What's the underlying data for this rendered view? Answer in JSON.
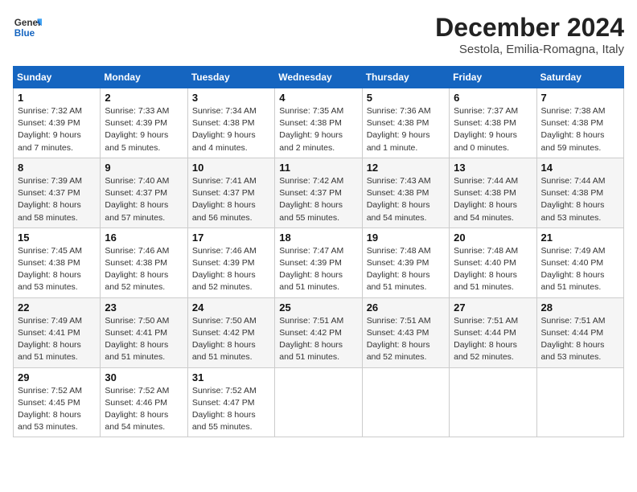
{
  "header": {
    "logo_general": "General",
    "logo_blue": "Blue",
    "month_title": "December 2024",
    "subtitle": "Sestola, Emilia-Romagna, Italy"
  },
  "days_of_week": [
    "Sunday",
    "Monday",
    "Tuesday",
    "Wednesday",
    "Thursday",
    "Friday",
    "Saturday"
  ],
  "weeks": [
    [
      {
        "day": 1,
        "info": "Sunrise: 7:32 AM\nSunset: 4:39 PM\nDaylight: 9 hours and 7 minutes."
      },
      {
        "day": 2,
        "info": "Sunrise: 7:33 AM\nSunset: 4:39 PM\nDaylight: 9 hours and 5 minutes."
      },
      {
        "day": 3,
        "info": "Sunrise: 7:34 AM\nSunset: 4:38 PM\nDaylight: 9 hours and 4 minutes."
      },
      {
        "day": 4,
        "info": "Sunrise: 7:35 AM\nSunset: 4:38 PM\nDaylight: 9 hours and 2 minutes."
      },
      {
        "day": 5,
        "info": "Sunrise: 7:36 AM\nSunset: 4:38 PM\nDaylight: 9 hours and 1 minute."
      },
      {
        "day": 6,
        "info": "Sunrise: 7:37 AM\nSunset: 4:38 PM\nDaylight: 9 hours and 0 minutes."
      },
      {
        "day": 7,
        "info": "Sunrise: 7:38 AM\nSunset: 4:38 PM\nDaylight: 8 hours and 59 minutes."
      }
    ],
    [
      {
        "day": 8,
        "info": "Sunrise: 7:39 AM\nSunset: 4:37 PM\nDaylight: 8 hours and 58 minutes."
      },
      {
        "day": 9,
        "info": "Sunrise: 7:40 AM\nSunset: 4:37 PM\nDaylight: 8 hours and 57 minutes."
      },
      {
        "day": 10,
        "info": "Sunrise: 7:41 AM\nSunset: 4:37 PM\nDaylight: 8 hours and 56 minutes."
      },
      {
        "day": 11,
        "info": "Sunrise: 7:42 AM\nSunset: 4:37 PM\nDaylight: 8 hours and 55 minutes."
      },
      {
        "day": 12,
        "info": "Sunrise: 7:43 AM\nSunset: 4:38 PM\nDaylight: 8 hours and 54 minutes."
      },
      {
        "day": 13,
        "info": "Sunrise: 7:44 AM\nSunset: 4:38 PM\nDaylight: 8 hours and 54 minutes."
      },
      {
        "day": 14,
        "info": "Sunrise: 7:44 AM\nSunset: 4:38 PM\nDaylight: 8 hours and 53 minutes."
      }
    ],
    [
      {
        "day": 15,
        "info": "Sunrise: 7:45 AM\nSunset: 4:38 PM\nDaylight: 8 hours and 53 minutes."
      },
      {
        "day": 16,
        "info": "Sunrise: 7:46 AM\nSunset: 4:38 PM\nDaylight: 8 hours and 52 minutes."
      },
      {
        "day": 17,
        "info": "Sunrise: 7:46 AM\nSunset: 4:39 PM\nDaylight: 8 hours and 52 minutes."
      },
      {
        "day": 18,
        "info": "Sunrise: 7:47 AM\nSunset: 4:39 PM\nDaylight: 8 hours and 51 minutes."
      },
      {
        "day": 19,
        "info": "Sunrise: 7:48 AM\nSunset: 4:39 PM\nDaylight: 8 hours and 51 minutes."
      },
      {
        "day": 20,
        "info": "Sunrise: 7:48 AM\nSunset: 4:40 PM\nDaylight: 8 hours and 51 minutes."
      },
      {
        "day": 21,
        "info": "Sunrise: 7:49 AM\nSunset: 4:40 PM\nDaylight: 8 hours and 51 minutes."
      }
    ],
    [
      {
        "day": 22,
        "info": "Sunrise: 7:49 AM\nSunset: 4:41 PM\nDaylight: 8 hours and 51 minutes."
      },
      {
        "day": 23,
        "info": "Sunrise: 7:50 AM\nSunset: 4:41 PM\nDaylight: 8 hours and 51 minutes."
      },
      {
        "day": 24,
        "info": "Sunrise: 7:50 AM\nSunset: 4:42 PM\nDaylight: 8 hours and 51 minutes."
      },
      {
        "day": 25,
        "info": "Sunrise: 7:51 AM\nSunset: 4:42 PM\nDaylight: 8 hours and 51 minutes."
      },
      {
        "day": 26,
        "info": "Sunrise: 7:51 AM\nSunset: 4:43 PM\nDaylight: 8 hours and 52 minutes."
      },
      {
        "day": 27,
        "info": "Sunrise: 7:51 AM\nSunset: 4:44 PM\nDaylight: 8 hours and 52 minutes."
      },
      {
        "day": 28,
        "info": "Sunrise: 7:51 AM\nSunset: 4:44 PM\nDaylight: 8 hours and 53 minutes."
      }
    ],
    [
      {
        "day": 29,
        "info": "Sunrise: 7:52 AM\nSunset: 4:45 PM\nDaylight: 8 hours and 53 minutes."
      },
      {
        "day": 30,
        "info": "Sunrise: 7:52 AM\nSunset: 4:46 PM\nDaylight: 8 hours and 54 minutes."
      },
      {
        "day": 31,
        "info": "Sunrise: 7:52 AM\nSunset: 4:47 PM\nDaylight: 8 hours and 55 minutes."
      },
      null,
      null,
      null,
      null
    ]
  ]
}
